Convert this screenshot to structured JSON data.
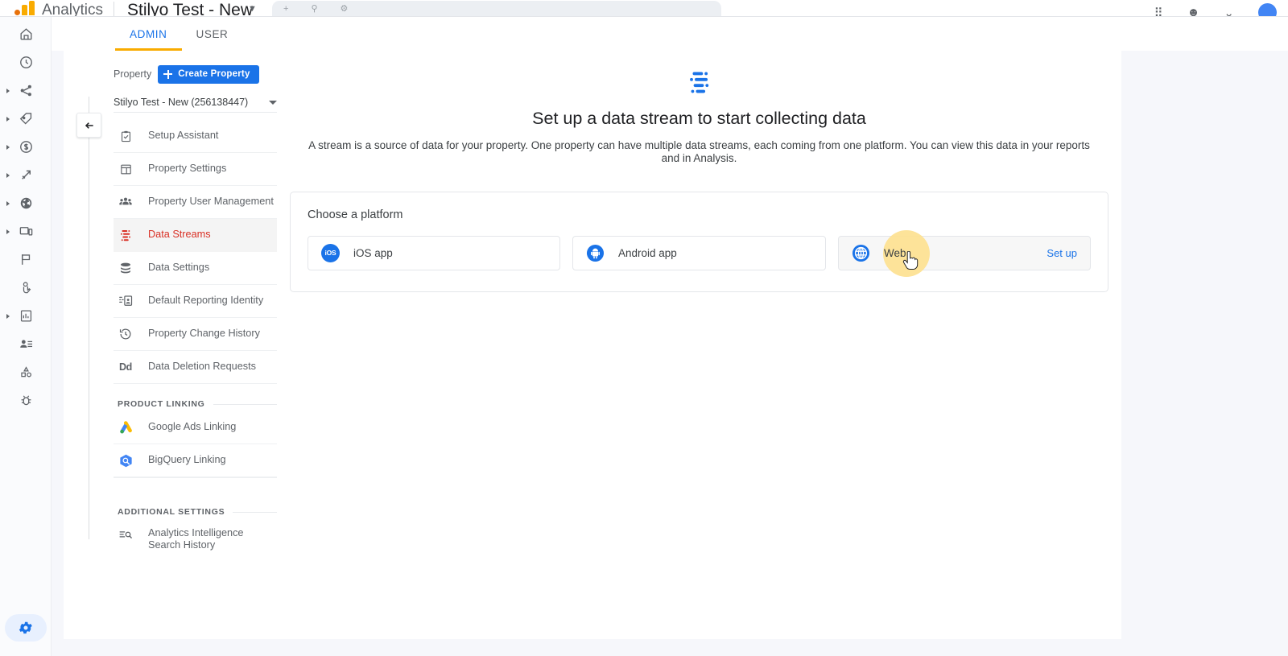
{
  "header": {
    "logo_icon": "google-analytics-logo",
    "product_name": "Analytics",
    "property_title": "Stilyo Test - New",
    "property_caret": "▼",
    "search_placeholder": "",
    "icons": [
      "apps-icon",
      "support-icon",
      "notifications-icon"
    ],
    "avatar": "user-avatar"
  },
  "rail": {
    "items": [
      {
        "name": "home-icon",
        "expandable": false
      },
      {
        "name": "realtime-clock-icon",
        "expandable": false
      },
      {
        "name": "acquisition-share-icon",
        "expandable": true
      },
      {
        "name": "engagement-tag-icon",
        "expandable": true
      },
      {
        "name": "monetization-dollar-icon",
        "expandable": true
      },
      {
        "name": "retention-arrow-icon",
        "expandable": true
      },
      {
        "name": "demographics-globe-icon",
        "expandable": true
      },
      {
        "name": "tech-devices-icon",
        "expandable": true
      },
      {
        "name": "events-flag-icon",
        "expandable": false
      },
      {
        "name": "conversions-hand-icon",
        "expandable": false
      },
      {
        "name": "analysis-report-icon",
        "expandable": true
      },
      {
        "name": "audiences-person-icon",
        "expandable": false
      },
      {
        "name": "shapes-icon",
        "expandable": false
      },
      {
        "name": "debug-bug-icon",
        "expandable": false
      }
    ],
    "settings_icon": "gear-icon"
  },
  "tabs": [
    {
      "label": "ADMIN",
      "active": true
    },
    {
      "label": "USER",
      "active": false
    }
  ],
  "property_column": {
    "label": "Property",
    "create_button": "Create Property",
    "selected_property": "Stilyo Test - New (256138447)",
    "menu": [
      {
        "label": "Setup Assistant",
        "icon": "clipboard-check-icon",
        "selected": false
      },
      {
        "label": "Property Settings",
        "icon": "layout-icon",
        "selected": false
      },
      {
        "label": "Property User Management",
        "icon": "people-icon",
        "selected": false
      },
      {
        "label": "Data Streams",
        "icon": "data-streams-icon",
        "selected": true
      },
      {
        "label": "Data Settings",
        "icon": "database-icon",
        "selected": false
      },
      {
        "label": "Default Reporting Identity",
        "icon": "identity-card-icon",
        "selected": false
      },
      {
        "label": "Property Change History",
        "icon": "history-clock-icon",
        "selected": false
      },
      {
        "label": "Data Deletion Requests",
        "icon": "dd-icon",
        "selected": false
      }
    ],
    "product_linking_header": "PRODUCT LINKING",
    "product_linking": [
      {
        "label": "Google Ads Linking",
        "icon": "google-ads-icon"
      },
      {
        "label": "BigQuery Linking",
        "icon": "bigquery-icon"
      }
    ],
    "additional_settings_header": "ADDITIONAL SETTINGS",
    "additional_settings": [
      {
        "label": "Analytics Intelligence Search History",
        "icon": "search-list-icon"
      }
    ]
  },
  "main": {
    "hero_icon": "data-streams-icon",
    "title": "Set up a data stream to start collecting data",
    "description": "A stream is a source of data for your property. One property can have multiple data streams, each coming from one platform. You can view this data in your reports and in Analysis.",
    "platform_card": {
      "heading": "Choose a platform",
      "options": [
        {
          "label": "iOS app",
          "icon": "ios-icon",
          "hovered": false,
          "action": ""
        },
        {
          "label": "Android app",
          "icon": "android-icon",
          "hovered": false,
          "action": ""
        },
        {
          "label": "Web",
          "icon": "globe-icon",
          "hovered": true,
          "action": "Set up"
        }
      ]
    }
  },
  "colors": {
    "accent_blue": "#1a73e8",
    "tab_underline": "#f9ab00",
    "selected_red": "#d93025",
    "hover_halo": "#fde293",
    "page_bg": "#f6f7fb"
  }
}
